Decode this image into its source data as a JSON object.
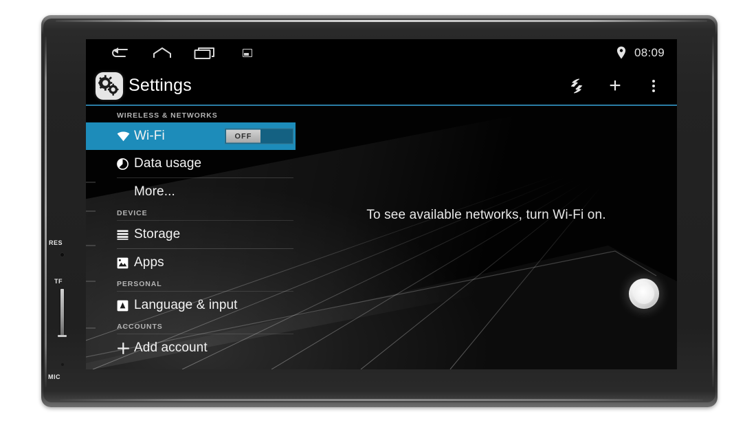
{
  "device": {
    "side_labels": {
      "reset": "RES",
      "tf_card": "TF",
      "microphone": "MIC"
    }
  },
  "status_bar": {
    "nav": [
      {
        "name": "back",
        "icon": "back-arrow-icon"
      },
      {
        "name": "home",
        "icon": "home-icon"
      },
      {
        "name": "recents",
        "icon": "recent-apps-icon"
      },
      {
        "name": "screenshot",
        "icon": "screenshot-icon"
      }
    ],
    "location_icon": "location-pin-icon",
    "time": "08:09"
  },
  "action_bar": {
    "app_icon": "settings-gear-icon",
    "title": "Settings",
    "actions": [
      {
        "name": "sync",
        "icon": "sync-bolt-icon"
      },
      {
        "name": "add",
        "icon": "plus-icon",
        "label": "+"
      },
      {
        "name": "overflow",
        "icon": "overflow-menu-icon"
      }
    ]
  },
  "settings_list": {
    "sections": [
      {
        "header": "WIRELESS & NETWORKS",
        "items": [
          {
            "label": "Wi-Fi",
            "icon": "wifi-icon",
            "selected": true,
            "toggle": {
              "state": "OFF"
            }
          },
          {
            "label": "Data usage",
            "icon": "data-usage-pie-icon",
            "selected": false
          },
          {
            "label": "More...",
            "icon": null,
            "selected": false
          }
        ]
      },
      {
        "header": "DEVICE",
        "items": [
          {
            "label": "Storage",
            "icon": "storage-lines-icon",
            "selected": false
          },
          {
            "label": "Apps",
            "icon": "apps-image-icon",
            "selected": false
          }
        ]
      },
      {
        "header": "PERSONAL",
        "items": [
          {
            "label": "Language & input",
            "icon": "language-input-icon",
            "selected": false
          }
        ]
      },
      {
        "header": "ACCOUNTS",
        "items": [
          {
            "label": "Add account",
            "icon": "plus-icon",
            "selected": false
          }
        ]
      }
    ]
  },
  "content_pane": {
    "empty_message": "To see available networks, turn Wi-Fi on."
  },
  "colors": {
    "accent_blue": "#1d8cba",
    "divider_blue": "#2b7ea6",
    "screen_black": "#000000",
    "text_primary": "#f2f2f2",
    "text_section": "#b4b4b4"
  }
}
